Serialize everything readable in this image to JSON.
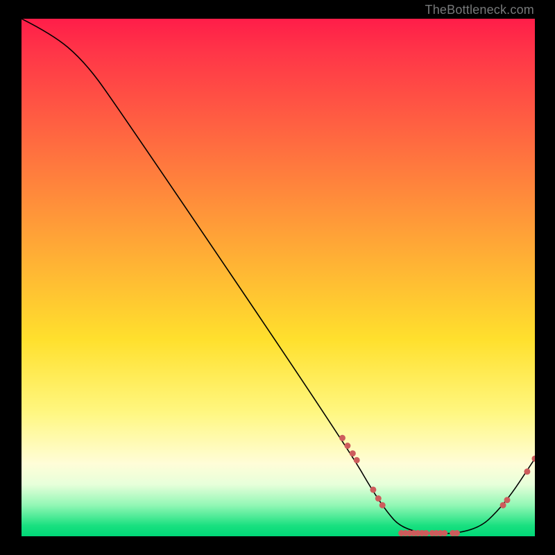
{
  "watermark": "TheBottleneck.com",
  "chart_data": {
    "type": "line",
    "title": "",
    "xlabel": "",
    "ylabel": "",
    "xlim": [
      0,
      100
    ],
    "ylim": [
      0,
      100
    ],
    "grid": false,
    "curve": [
      {
        "x": 0,
        "y": 100
      },
      {
        "x": 6,
        "y": 97
      },
      {
        "x": 12,
        "y": 92
      },
      {
        "x": 18,
        "y": 84
      },
      {
        "x": 63,
        "y": 18
      },
      {
        "x": 70,
        "y": 6
      },
      {
        "x": 75,
        "y": 0.5
      },
      {
        "x": 88,
        "y": 0.5
      },
      {
        "x": 94,
        "y": 6
      },
      {
        "x": 100,
        "y": 15
      }
    ],
    "markers": [
      {
        "x": 62.5,
        "y": 19.0
      },
      {
        "x": 63.5,
        "y": 17.5
      },
      {
        "x": 64.5,
        "y": 16.0
      },
      {
        "x": 65.3,
        "y": 14.7
      },
      {
        "x": 68.5,
        "y": 9.0
      },
      {
        "x": 69.5,
        "y": 7.3
      },
      {
        "x": 70.3,
        "y": 6.0
      },
      {
        "x": 74.0,
        "y": 0.6
      },
      {
        "x": 74.8,
        "y": 0.6
      },
      {
        "x": 75.6,
        "y": 0.6
      },
      {
        "x": 76.4,
        "y": 0.6
      },
      {
        "x": 77.2,
        "y": 0.6
      },
      {
        "x": 78.0,
        "y": 0.6
      },
      {
        "x": 78.8,
        "y": 0.6
      },
      {
        "x": 80.0,
        "y": 0.6
      },
      {
        "x": 80.8,
        "y": 0.6
      },
      {
        "x": 81.6,
        "y": 0.6
      },
      {
        "x": 82.4,
        "y": 0.6
      },
      {
        "x": 84.0,
        "y": 0.6
      },
      {
        "x": 84.8,
        "y": 0.6
      },
      {
        "x": 93.8,
        "y": 6.0
      },
      {
        "x": 94.6,
        "y": 7.0
      },
      {
        "x": 98.5,
        "y": 12.5
      },
      {
        "x": 100.0,
        "y": 15.0
      }
    ],
    "marker_radius_px": 4.5,
    "gradient_stops": [
      {
        "pos": 0.0,
        "color": "#ff1d49"
      },
      {
        "pos": 0.5,
        "color": "#ffc030"
      },
      {
        "pos": 0.8,
        "color": "#fff780"
      },
      {
        "pos": 1.0,
        "color": "#00d878"
      }
    ]
  }
}
